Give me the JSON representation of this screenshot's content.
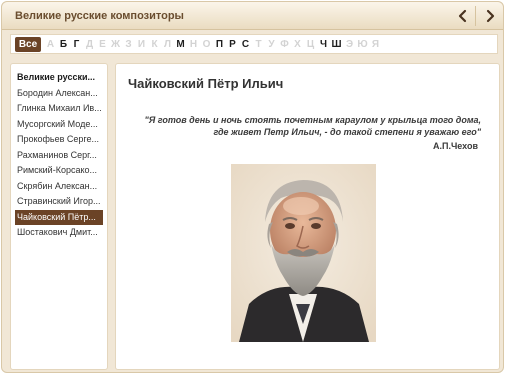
{
  "window": {
    "title": "Великие русские композиторы"
  },
  "icons": {
    "prev": "chevron-left-icon",
    "next": "chevron-right-icon"
  },
  "alphabet": {
    "all_label": "Все",
    "letters": [
      {
        "char": "А",
        "active": false
      },
      {
        "char": "Б",
        "active": true
      },
      {
        "char": "Г",
        "active": true
      },
      {
        "char": "Д",
        "active": false
      },
      {
        "char": "Е",
        "active": false
      },
      {
        "char": "Ж",
        "active": false
      },
      {
        "char": "З",
        "active": false
      },
      {
        "char": "И",
        "active": false
      },
      {
        "char": "К",
        "active": false
      },
      {
        "char": "Л",
        "active": false
      },
      {
        "char": "М",
        "active": true
      },
      {
        "char": "Н",
        "active": false
      },
      {
        "char": "О",
        "active": false
      },
      {
        "char": "П",
        "active": true
      },
      {
        "char": "Р",
        "active": true
      },
      {
        "char": "С",
        "active": true
      },
      {
        "char": "Т",
        "active": false
      },
      {
        "char": "У",
        "active": false
      },
      {
        "char": "Ф",
        "active": false
      },
      {
        "char": "Х",
        "active": false
      },
      {
        "char": "Ц",
        "active": false
      },
      {
        "char": "Ч",
        "active": true
      },
      {
        "char": "Ш",
        "active": true
      },
      {
        "char": "Э",
        "active": false
      },
      {
        "char": "Ю",
        "active": false
      },
      {
        "char": "Я",
        "active": false
      }
    ]
  },
  "sidebar": {
    "items": [
      {
        "label": "Великие русски...",
        "kind": "header"
      },
      {
        "label": "Бородин Алексан...",
        "kind": "item"
      },
      {
        "label": "Глинка Михаил Ив...",
        "kind": "item"
      },
      {
        "label": "Мусоргский Моде...",
        "kind": "item"
      },
      {
        "label": "Прокофьев Серге...",
        "kind": "item"
      },
      {
        "label": "Рахманинов Серг...",
        "kind": "item"
      },
      {
        "label": "Римский-Корсако...",
        "kind": "item"
      },
      {
        "label": "Скрябин Алексан...",
        "kind": "item"
      },
      {
        "label": "Стравинский Игор...",
        "kind": "item"
      },
      {
        "label": "Чайковский Пётр...",
        "kind": "selected"
      },
      {
        "label": "Шостакович Дмит...",
        "kind": "item"
      }
    ]
  },
  "content": {
    "name": "Чайковский Пётр Ильич",
    "quote_line1": "\"Я готов день и ночь стоять почетным караулом у крыльца того дома,",
    "quote_line2": "где живет Петр Ильич, - до такой степени я уважаю его\"",
    "quote_author": "А.П.Чехов"
  },
  "colors": {
    "accent": "#6b4326",
    "background": "#f1e7d6",
    "title_text": "#6a4d2f"
  }
}
